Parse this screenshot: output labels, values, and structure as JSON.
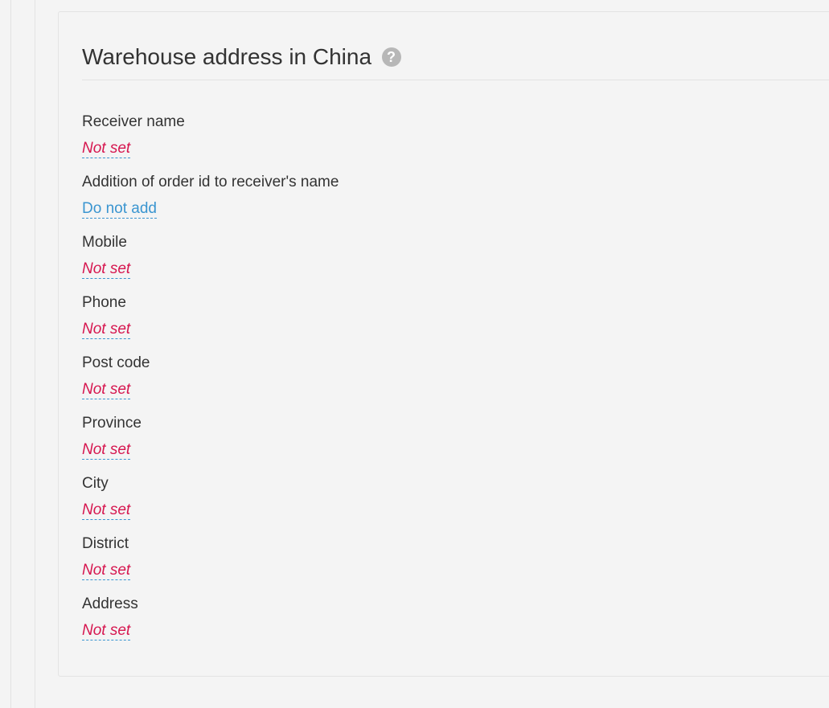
{
  "section": {
    "title": "Warehouse address in China",
    "help_icon": "question-circle-icon"
  },
  "colors": {
    "unset_value": "#d6164f",
    "link_value": "#3a95d0",
    "help_icon": "#b7b7b7"
  },
  "fields": [
    {
      "label": "Receiver name",
      "value": "Not set",
      "state": "unset"
    },
    {
      "label": "Addition of order id to receiver's name",
      "value": "Do not add",
      "state": "set"
    },
    {
      "label": "Mobile",
      "value": "Not set",
      "state": "unset"
    },
    {
      "label": "Phone",
      "value": "Not set",
      "state": "unset"
    },
    {
      "label": "Post code",
      "value": "Not set",
      "state": "unset"
    },
    {
      "label": "Province",
      "value": "Not set",
      "state": "unset"
    },
    {
      "label": "City",
      "value": "Not set",
      "state": "unset"
    },
    {
      "label": "District",
      "value": "Not set",
      "state": "unset"
    },
    {
      "label": "Address",
      "value": "Not set",
      "state": "unset"
    }
  ]
}
